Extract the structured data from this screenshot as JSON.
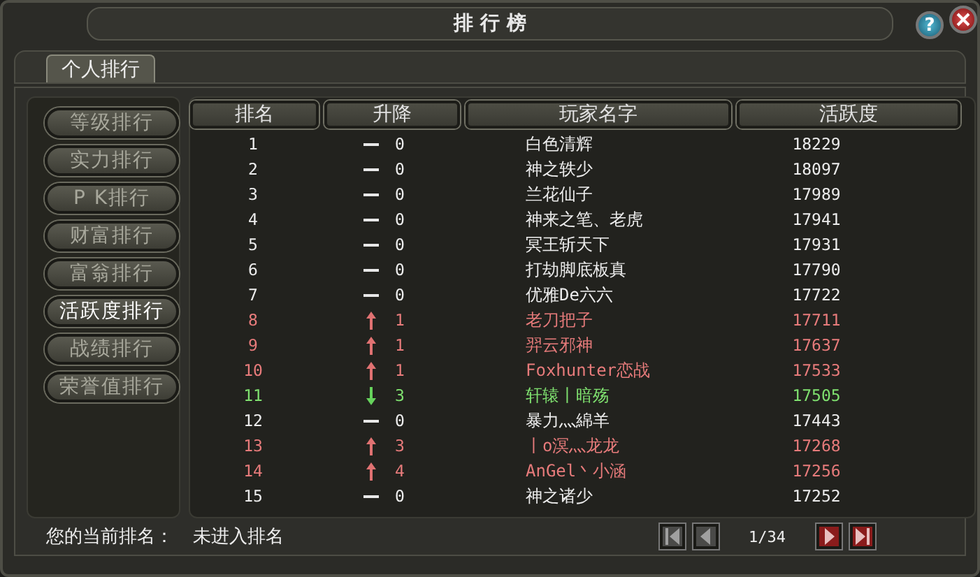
{
  "window": {
    "title": "排 行 榜",
    "help": "?"
  },
  "tabs": [
    {
      "label": "个人排行",
      "selected": true
    }
  ],
  "categories": [
    {
      "label": "等级排行",
      "selected": false
    },
    {
      "label": "实力排行",
      "selected": false
    },
    {
      "label": "P K排行",
      "selected": false
    },
    {
      "label": "财富排行",
      "selected": false
    },
    {
      "label": "富翁排行",
      "selected": false
    },
    {
      "label": "活跃度排行",
      "selected": true
    },
    {
      "label": "战绩排行",
      "selected": false
    },
    {
      "label": "荣誉值排行",
      "selected": false
    }
  ],
  "table": {
    "columns": [
      "排名",
      "升降",
      "玩家名字",
      "活跃度"
    ],
    "rows": [
      {
        "rank": "1",
        "kind": "same",
        "change": "0",
        "name": "白色清辉",
        "score": "18229"
      },
      {
        "rank": "2",
        "kind": "same",
        "change": "0",
        "name": "神之轶少",
        "score": "18097"
      },
      {
        "rank": "3",
        "kind": "same",
        "change": "0",
        "name": "兰花仙子",
        "score": "17989"
      },
      {
        "rank": "4",
        "kind": "same",
        "change": "0",
        "name": "神来之笔、老虎",
        "score": "17941"
      },
      {
        "rank": "5",
        "kind": "same",
        "change": "0",
        "name": "冥王斩天下",
        "score": "17931"
      },
      {
        "rank": "6",
        "kind": "same",
        "change": "0",
        "name": "打劫脚底板真",
        "score": "17790"
      },
      {
        "rank": "7",
        "kind": "same",
        "change": "0",
        "name": "优雅De六六",
        "score": "17722"
      },
      {
        "rank": "8",
        "kind": "up",
        "change": "1",
        "name": "老刀把子",
        "score": "17711"
      },
      {
        "rank": "9",
        "kind": "up",
        "change": "1",
        "name": "羿云邪神",
        "score": "17637"
      },
      {
        "rank": "10",
        "kind": "up",
        "change": "1",
        "name": "Foxhunter恋战",
        "score": "17533"
      },
      {
        "rank": "11",
        "kind": "down",
        "change": "3",
        "name": "轩辕丨暗殇",
        "score": "17505"
      },
      {
        "rank": "12",
        "kind": "same",
        "change": "0",
        "name": "暴力灬綿羊",
        "score": "17443"
      },
      {
        "rank": "13",
        "kind": "up",
        "change": "3",
        "name": "丨o溟灬龙龙",
        "score": "17268"
      },
      {
        "rank": "14",
        "kind": "up",
        "change": "4",
        "name": "AnGel丶小涵",
        "score": "17256"
      },
      {
        "rank": "15",
        "kind": "same",
        "change": "0",
        "name": "神之诸少",
        "score": "17252"
      }
    ]
  },
  "status": {
    "label": "您的当前排名：",
    "value": "未进入排名"
  },
  "pager": {
    "page": "1/34",
    "first_disabled": true,
    "prev_disabled": true,
    "next_disabled": false,
    "last_disabled": false
  }
}
